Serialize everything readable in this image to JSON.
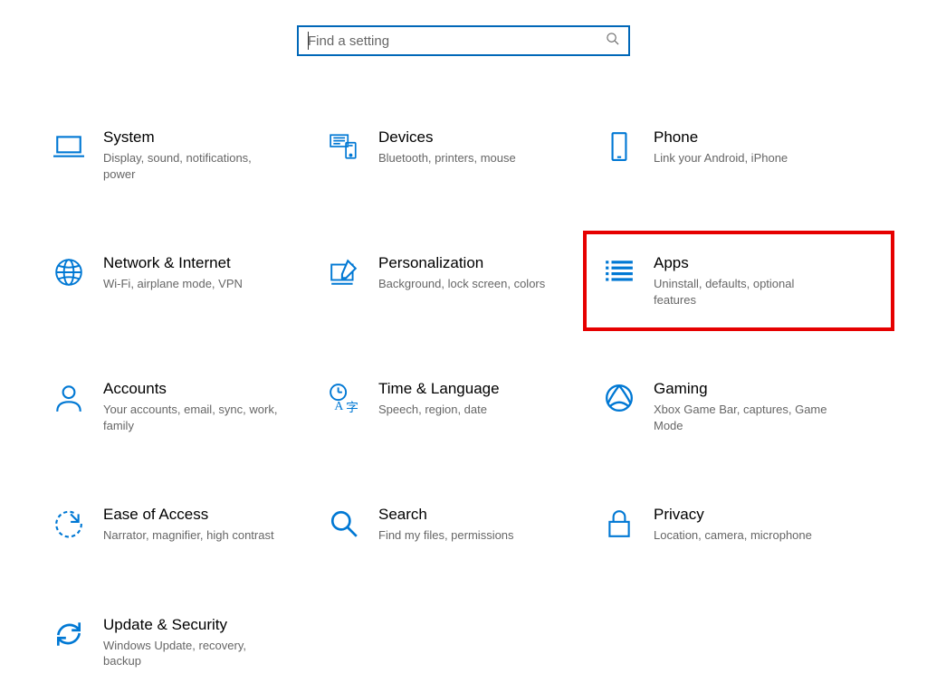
{
  "search": {
    "placeholder": "Find a setting"
  },
  "tiles": {
    "system": {
      "title": "System",
      "desc": "Display, sound, notifications, power"
    },
    "devices": {
      "title": "Devices",
      "desc": "Bluetooth, printers, mouse"
    },
    "phone": {
      "title": "Phone",
      "desc": "Link your Android, iPhone"
    },
    "network": {
      "title": "Network & Internet",
      "desc": "Wi-Fi, airplane mode, VPN"
    },
    "personalization": {
      "title": "Personalization",
      "desc": "Background, lock screen, colors"
    },
    "apps": {
      "title": "Apps",
      "desc": "Uninstall, defaults, optional features"
    },
    "accounts": {
      "title": "Accounts",
      "desc": "Your accounts, email, sync, work, family"
    },
    "time": {
      "title": "Time & Language",
      "desc": "Speech, region, date"
    },
    "gaming": {
      "title": "Gaming",
      "desc": "Xbox Game Bar, captures, Game Mode"
    },
    "ease": {
      "title": "Ease of Access",
      "desc": "Narrator, magnifier, high contrast"
    },
    "searchcat": {
      "title": "Search",
      "desc": "Find my files, permissions"
    },
    "privacy": {
      "title": "Privacy",
      "desc": "Location, camera, microphone"
    },
    "update": {
      "title": "Update & Security",
      "desc": "Windows Update, recovery, backup"
    }
  },
  "colors": {
    "accent": "#0078d4",
    "highlight": "#e60000"
  }
}
